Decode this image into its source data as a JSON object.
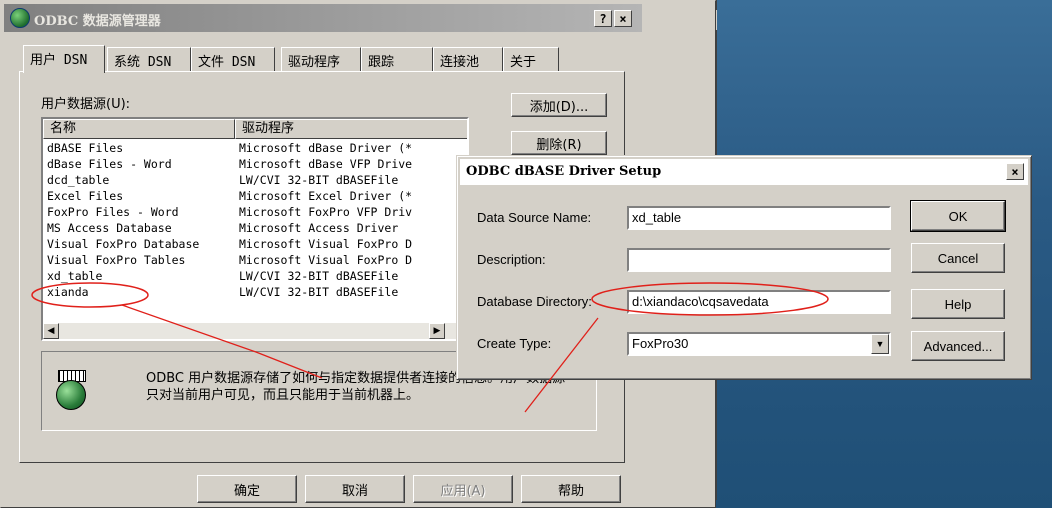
{
  "odbc": {
    "title": "ODBC 数据源管理器",
    "help_btn": "?",
    "close_btn": "×",
    "tabs": [
      "用户 DSN",
      "系统 DSN",
      "文件 DSN",
      "驱动程序",
      "跟踪",
      "连接池",
      "关于"
    ],
    "list_label": "用户数据源(U):",
    "columns": [
      "名称",
      "驱动程序"
    ],
    "rows": [
      {
        "name": "dBASE Files",
        "driver": "Microsoft dBase Driver (*"
      },
      {
        "name": "dBase Files - Word",
        "driver": "Microsoft dBase VFP Drive"
      },
      {
        "name": "dcd_table",
        "driver": "LW/CVI 32-BIT dBASEFile"
      },
      {
        "name": "Excel Files",
        "driver": "Microsoft Excel Driver (*"
      },
      {
        "name": "FoxPro Files - Word",
        "driver": "Microsoft FoxPro VFP Driv"
      },
      {
        "name": "MS Access Database",
        "driver": "Microsoft Access Driver"
      },
      {
        "name": "Visual FoxPro Database",
        "driver": "Microsoft Visual FoxPro D"
      },
      {
        "name": "Visual FoxPro Tables",
        "driver": "Microsoft Visual FoxPro D"
      },
      {
        "name": "xd_table",
        "driver": "LW/CVI 32-BIT dBASEFile"
      },
      {
        "name": "xianda",
        "driver": "LW/CVI 32-BIT dBASEFile"
      }
    ],
    "add_btn": "添加(D)...",
    "remove_btn": "删除(R)",
    "info_text": "ODBC 用户数据源存储了如何与指定数据提供者连接的信息。用户数据源只对当前用户可见，而且只能用于当前机器上。",
    "ok_btn": "确定",
    "cancel_btn": "取消",
    "apply_btn": "应用(A)",
    "help_button": "帮助"
  },
  "bg_window": {
    "minimize": "_",
    "maximize": "□",
    "close": "×"
  },
  "setup": {
    "title": "ODBC dBASE Driver Setup",
    "close": "×",
    "labels": {
      "dsn": "Data Source Name:",
      "description": "Description:",
      "directory": "Database Directory:",
      "create_type": "Create Type:"
    },
    "values": {
      "dsn": "xd_table",
      "description": "",
      "directory": "d:\\xiandaco\\cqsavedata",
      "create_type": "FoxPro30"
    },
    "buttons": {
      "ok": "OK",
      "cancel": "Cancel",
      "help": "Help",
      "advanced": "Advanced..."
    }
  },
  "colors": {
    "face": "#d4d0c8",
    "desktop": "#2a5a84",
    "annotation": "#e0201a"
  }
}
